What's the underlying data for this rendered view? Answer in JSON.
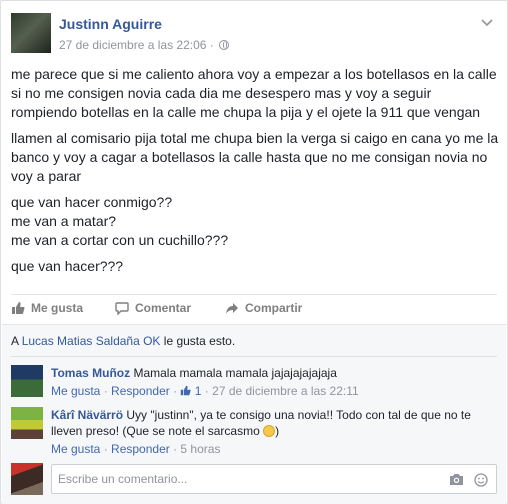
{
  "post": {
    "author": "Justinn Aguirre",
    "timestamp": "27 de diciembre a las 22:06",
    "dot": "·",
    "paragraphs": [
      "me parece que si me caliento ahora voy a empezar a los botellasos en la calle si no me consigen novia cada dia me desespero mas y voy a seguir rompiendo botellas en la calle me chupa la pija y el ojete la 911 que vengan",
      "llamen al comisario pija total me chupa bien la verga si caigo en cana yo me la banco y voy a cagar a botellasos la calle hasta que no me consigan novia no voy a parar",
      "que van hacer conmigo??\nme van a matar?\nme van a cortar con un cuchillo???",
      "que van hacer???"
    ]
  },
  "actions": {
    "like": "Me gusta",
    "comment": "Comentar",
    "share": "Compartir"
  },
  "likes": {
    "prefix": "A",
    "names": "Lucas Matias Saldaña OK",
    "suffix": "le gusta esto."
  },
  "comments": [
    {
      "name": "Tomas Muñoz",
      "text": "Mamala mamala mamala jajajajajajaja",
      "like": "Me gusta",
      "reply": "Responder",
      "like_count": "1",
      "time": "27 de diciembre a las 22:11"
    },
    {
      "name": "Kârî Nävärrö",
      "text": "Uyy \"justinn\", ya te consigo una novia!! Todo con tal de que no te lleven preso! (Que se note el sarcasmo",
      "text_end": ")",
      "like": "Me gusta",
      "reply": "Responder",
      "time": "5 horas"
    }
  ],
  "composer": {
    "placeholder": "Escribe un comentario..."
  },
  "colors": {
    "link": "#365899",
    "muted": "#90949c",
    "action": "#7f7f7f",
    "lower_bg": "#f6f7f9"
  }
}
